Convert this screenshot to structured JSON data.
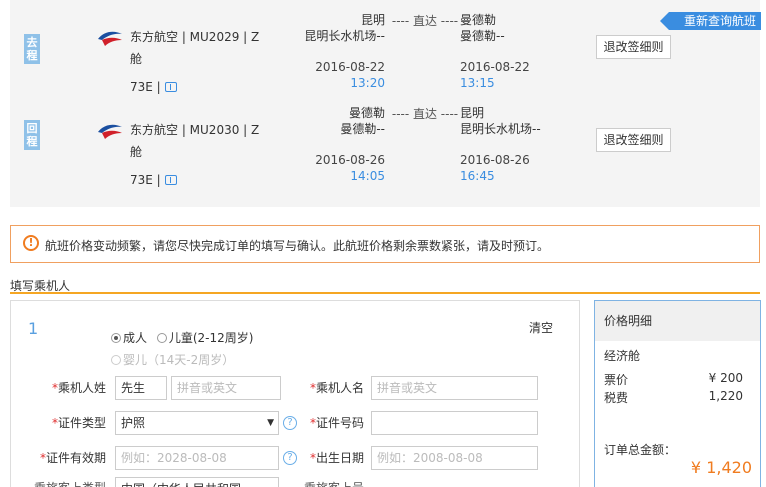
{
  "requery_label": "重新查询航班",
  "flights": [
    {
      "dir_label": "去程",
      "airline": "东方航空 | MU2029 | Z舱",
      "aircraft": "73E |",
      "dep_city": "昆明",
      "dep_airport": "昆明长水机场--",
      "dep_date": "2016-08-22",
      "dep_time": "13:20",
      "route_type": "---- 直达 ----",
      "arr_city": "曼德勒",
      "arr_airport": "曼德勒--",
      "arr_date": "2016-08-22",
      "arr_time": "13:15",
      "rule_label": "退改签细则"
    },
    {
      "dir_label": "回程",
      "airline": "东方航空 | MU2030 | Z舱",
      "aircraft": "73E |",
      "dep_city": "曼德勒",
      "dep_airport": "曼德勒--",
      "dep_date": "2016-08-26",
      "dep_time": "14:05",
      "route_type": "---- 直达 ----",
      "arr_city": "昆明",
      "arr_airport": "昆明长水机场--",
      "arr_date": "2016-08-26",
      "arr_time": "16:45",
      "rule_label": "退改签细则"
    }
  ],
  "notice_icon": "warning-icon",
  "notice": "航班价格变动频繁，请您尽快完成订单的填写与确认。此航班价格剩余票数紧张，请及时预订。",
  "section_title": "填写乘机人",
  "passenger": {
    "index": "1",
    "clear_label": "清空",
    "type_adult": "成人",
    "type_child": "儿童(2-12周岁)",
    "type_infant": "婴儿（14天-2周岁）",
    "surname_label": "乘机人姓",
    "surname_select": "先生",
    "surname_placeholder": "拼音或英文",
    "name_label": "乘机人名",
    "name_placeholder": "拼音或英文",
    "id_type_label": "证件类型",
    "id_type_value": "护照",
    "id_number_label": "证件号码",
    "id_expiry_label": "证件有效期",
    "id_expiry_placeholder": "例如：2028-08-08",
    "birth_label": "出生日期",
    "birth_placeholder": "例如：2008-08-08",
    "passenger_type_label": "乘旅客上类型",
    "passenger_type_value": "中国（中华人民共和国",
    "passenger_no_label": "乘旅客上号"
  },
  "price": {
    "title": "价格明细",
    "cabin": "经济舱",
    "fare_label": "票价",
    "fare_value": "¥ 200",
    "tax_label": "税费",
    "tax_value": "1,220",
    "total_label": "订单总金额：",
    "total_value": "¥ 1,420"
  },
  "colors": {
    "accent": "#3a8de0",
    "orange": "#f07c20",
    "tag": "#8fc1e8"
  }
}
